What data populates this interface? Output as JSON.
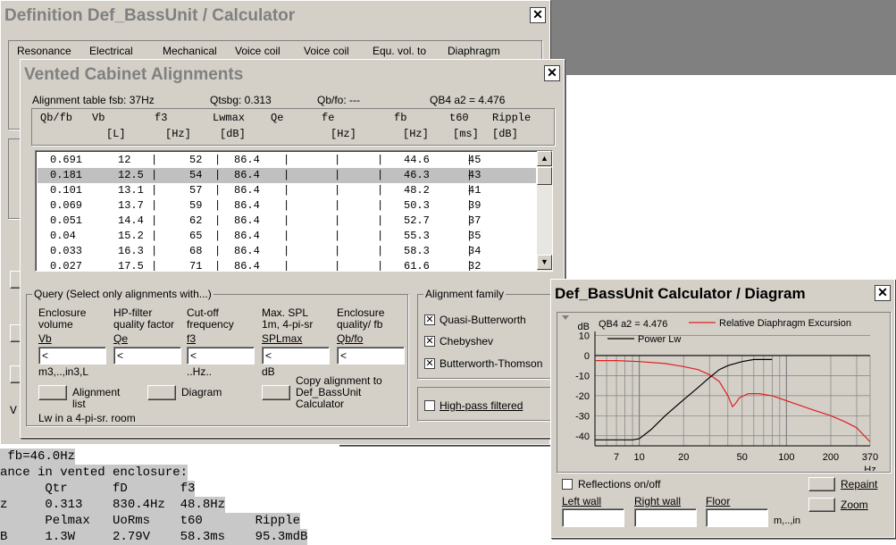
{
  "calc_window": {
    "title": "Definition Def_BassUnit / Calculator",
    "close": "✕",
    "tabs": [
      "Resonance",
      "Electrical",
      "Mechanical",
      "Voice coil",
      "Voice coil",
      "Equ. vol. to",
      "Diaphragm"
    ],
    "status_prefix": "V"
  },
  "background_text": [
    " fb=46.0Hz",
    "ance in vented enclosure:",
    "      Qtr      fD       f3",
    "z     0.313    830.4Hz  48.8Hz",
    "      Pelmax   UoRms    t60       Ripple",
    "B     1.3W     2.79V    58.3ms    95.3mdB"
  ],
  "vca_window": {
    "title": "Vented Cabinet Alignments",
    "close": "✕",
    "info": {
      "table_label": "Alignment table fsb:  37Hz",
      "qtsbg": "Qtsbg:  0.313",
      "qbfo": "Qb/fo:  ---",
      "qb4": "QB4 a2 = 4.476"
    },
    "headers": [
      {
        "name": "Qb/fb",
        "unit": ""
      },
      {
        "name": "Vb",
        "unit": "[L]"
      },
      {
        "name": "f3",
        "unit": "[Hz]"
      },
      {
        "name": "Lwmax",
        "unit": "[dB]"
      },
      {
        "name": "Qe",
        "unit": ""
      },
      {
        "name": "fe",
        "unit": "[Hz]"
      },
      {
        "name": "fb",
        "unit": "[Hz]"
      },
      {
        "name": "t60",
        "unit": "[ms]"
      },
      {
        "name": "Ripple",
        "unit": "[dB]"
      }
    ],
    "rows": [
      [
        "0.691",
        "12",
        "52",
        "86.4",
        "44.6",
        "45"
      ],
      [
        "0.181",
        "12.5",
        "54",
        "86.4",
        "46.3",
        "43"
      ],
      [
        "0.101",
        "13.1",
        "57",
        "86.4",
        "48.2",
        "41"
      ],
      [
        "0.069",
        "13.7",
        "59",
        "86.4",
        "50.3",
        "39"
      ],
      [
        "0.051",
        "14.4",
        "62",
        "86.4",
        "52.7",
        "37"
      ],
      [
        "0.04",
        "15.2",
        "65",
        "86.4",
        "55.3",
        "35"
      ],
      [
        "0.033",
        "16.3",
        "68",
        "86.4",
        "58.3",
        "34"
      ],
      [
        "0.027",
        "17.5",
        "71",
        "86.4",
        "61.6",
        "32"
      ]
    ],
    "selected_row": 1,
    "query": {
      "title": "Query (Select only alignments with...)",
      "cols": [
        {
          "l1": "Enclosure",
          "l2": "volume",
          "key": "Vb",
          "value": "<",
          "unit": "m3,..,in3,L"
        },
        {
          "l1": "HP-filter",
          "l2": "quality factor",
          "key": "Qe",
          "value": "<",
          "unit": ""
        },
        {
          "l1": "Cut-off",
          "l2": "frequency",
          "key": "f3",
          "value": "<",
          "unit": "..Hz.."
        },
        {
          "l1": "Max. SPL",
          "l2": "1m, 4-pi-sr",
          "key": "SPLmax",
          "value": "<",
          "unit": "dB"
        },
        {
          "l1": "Enclosure",
          "l2": "quality/ fb",
          "key": "Qb/fo",
          "value": "<",
          "unit": ""
        }
      ],
      "alignment_list": "Alignment\nlist",
      "diagram": "Diagram",
      "copy_l1": "Copy alignment to",
      "copy_l2": "Def_BassUnit",
      "copy_l3": "Calculator",
      "note": "Lw in a 4-pi-sr. room"
    },
    "family": {
      "title": "Alignment family",
      "items": [
        {
          "label": "Quasi-Butterworth",
          "checked": true
        },
        {
          "label": "Chebyshev",
          "checked": true
        },
        {
          "label": "Butterworth-Thomson",
          "checked": true
        }
      ],
      "highpass": "High-pass filtered"
    }
  },
  "diag_window": {
    "title": "Def_BassUnit Calculator / Diagram",
    "close": "✕",
    "repaint": "Repaint",
    "zoom": "Zoom",
    "reflections": "Reflections on/off",
    "walls": [
      "Left wall",
      "Right wall",
      "Floor"
    ],
    "units": "m,..,in",
    "colors": {
      "excursion": "#e02020",
      "power": "#000000"
    }
  },
  "chart_data": {
    "type": "line",
    "title": "QB4 a2 = 4.476",
    "ylabel": "dB",
    "xlabel": "Hz",
    "x_scale": "log",
    "xlim": [
      5,
      370
    ],
    "ylim": [
      -45,
      12
    ],
    "x_ticks": [
      7,
      10,
      20,
      50,
      100,
      200,
      370
    ],
    "y_ticks": [
      10,
      0,
      -10,
      -20,
      -30,
      -40
    ],
    "grid": true,
    "series": [
      {
        "name": "Relative Diaphragm Excursion",
        "color": "#e02020",
        "x": [
          5,
          7,
          10,
          15,
          20,
          25,
          30,
          35,
          40,
          43,
          45,
          48,
          55,
          65,
          80,
          100,
          150,
          200,
          250,
          300,
          370
        ],
        "y": [
          -2.5,
          -2.5,
          -3,
          -4,
          -5.5,
          -7,
          -9.5,
          -13,
          -20,
          -25.5,
          -24,
          -21,
          -19,
          -19,
          -20,
          -22.5,
          -27,
          -30,
          -33,
          -36,
          -43
        ]
      },
      {
        "name": "Power Lw",
        "color": "#000000",
        "x": [
          5,
          9,
          10,
          12,
          15,
          20,
          25,
          30,
          35,
          40,
          50,
          60,
          70,
          80
        ],
        "y": [
          -42,
          -42,
          -41.5,
          -37,
          -30,
          -22,
          -16,
          -11,
          -7,
          -5,
          -3,
          -2,
          -2,
          -2
        ]
      }
    ]
  }
}
